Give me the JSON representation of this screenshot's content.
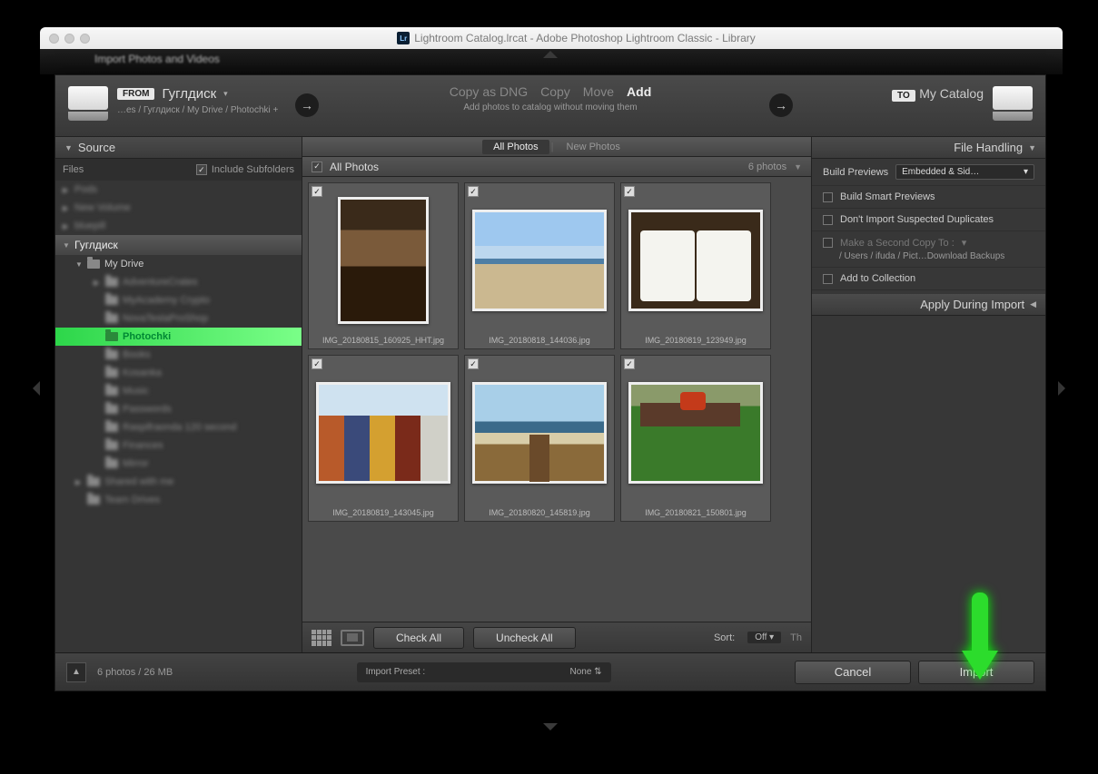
{
  "window": {
    "title": "Lightroom Catalog.lrcat - Adobe Photoshop Lightroom Classic - Library",
    "behind_text": "Import Photos and Videos"
  },
  "header": {
    "from_label": "FROM",
    "source_name": "Гуглдиск",
    "source_path": "…es / Гуглдиск / My Drive / Photochki +",
    "actions": {
      "copy_dng": "Copy as DNG",
      "copy": "Copy",
      "move": "Move",
      "add": "Add",
      "subtitle": "Add photos to catalog without moving them"
    },
    "to_label": "TO",
    "dest_name": "My Catalog"
  },
  "left": {
    "panel_title": "Source",
    "files_label": "Files",
    "include_sub": "Include Subfolders",
    "dim_rows": [
      "Pods",
      "New Volume",
      "bluepill"
    ],
    "root_label": "Гуглдиск",
    "my_drive": "My Drive",
    "children_dim": [
      "AdventureCrates",
      "MyAcademy Crypto",
      "NovaTeslaProShop"
    ],
    "selected": "Photochki",
    "children_dim2": [
      "Books",
      "Kosanka",
      "Music",
      "Passwords",
      "Raspifraonda 120 second",
      "Finances",
      "Mirror",
      "Shared with me",
      "Team Drives"
    ]
  },
  "center": {
    "tabs": {
      "all": "All Photos",
      "new": "New Photos"
    },
    "grid_title": "All Photos",
    "count": "6 photos",
    "filenames": [
      "IMG_20180815_160925_HHT.jpg",
      "IMG_20180818_144036.jpg",
      "IMG_20180819_123949.jpg",
      "IMG_20180819_143045.jpg",
      "IMG_20180820_145819.jpg",
      "IMG_20180821_150801.jpg"
    ],
    "check_all": "Check All",
    "uncheck_all": "Uncheck All",
    "sort_label": "Sort:",
    "sort_value": "Off",
    "thumb_label": "Th"
  },
  "right": {
    "file_handling": "File Handling",
    "build_previews_label": "Build Previews",
    "build_previews_value": "Embedded & Sid…",
    "smart_previews": "Build Smart Previews",
    "no_dup": "Don't Import Suspected Duplicates",
    "second_copy": "Make a Second Copy To :",
    "second_copy_path": "/ Users / ifuda / Pict…Download Backups",
    "add_collection": "Add to Collection",
    "apply_during": "Apply During Import"
  },
  "footer": {
    "stats": "6 photos / 26 MB",
    "preset_label": "Import Preset :",
    "preset_value": "None",
    "cancel": "Cancel",
    "import": "Import"
  }
}
